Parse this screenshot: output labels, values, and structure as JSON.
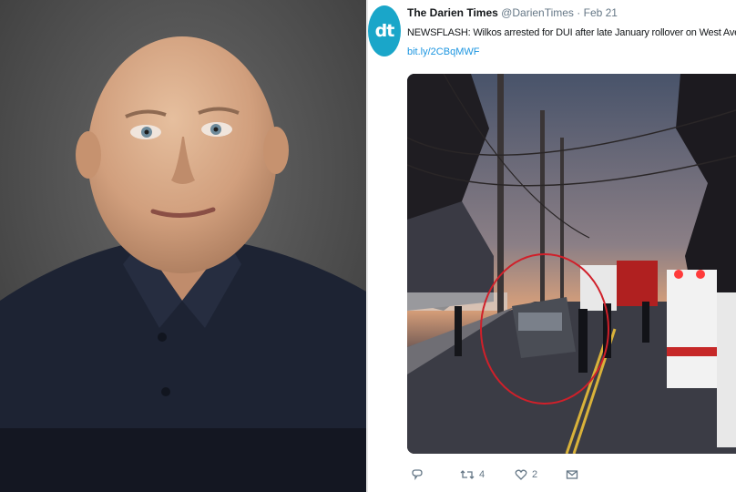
{
  "mugshot": {
    "icon": "mugshot-photo"
  },
  "tweet": {
    "avatar_text": "dt",
    "display_name": "The Darien Times",
    "handle": "@DarienTimes",
    "separator": "·",
    "date": "Feb 21",
    "text": "NEWSFLASH: Wilkos arrested for DUI after late January rollover on West Avenue",
    "link": "bit.ly/2CBqMWF",
    "photo": {
      "icon": "accident-scene-photo"
    },
    "actions": {
      "reply_icon": "reply-icon",
      "retweet_icon": "retweet-icon",
      "retweet_count": "4",
      "like_icon": "heart-icon",
      "like_count": "2",
      "dm_icon": "envelope-icon"
    }
  },
  "colors": {
    "brand_avatar": "#1aa6c9",
    "link": "#1b95e0",
    "muted": "#657786",
    "circle_annotation": "#d0202a"
  }
}
